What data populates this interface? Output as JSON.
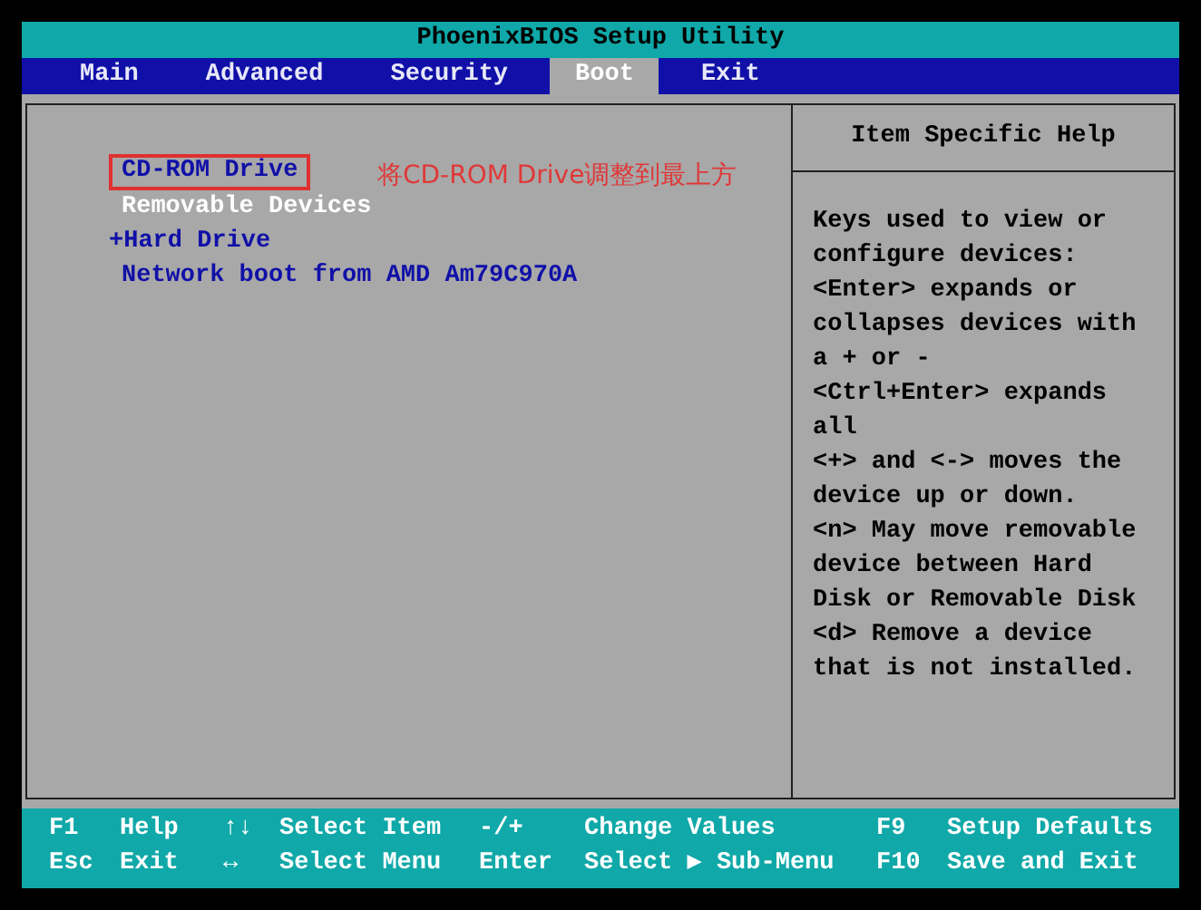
{
  "window": {
    "title": "PhoenixBIOS Setup Utility"
  },
  "tabs": [
    {
      "label": "Main",
      "selected": false
    },
    {
      "label": "Advanced",
      "selected": false
    },
    {
      "label": "Security",
      "selected": false
    },
    {
      "label": "Boot",
      "selected": true
    },
    {
      "label": "Exit",
      "selected": false
    }
  ],
  "boot_order": [
    {
      "label": "CD-ROM Drive",
      "kind": "device",
      "selected": false,
      "annotated": true
    },
    {
      "label": "Removable Devices",
      "kind": "device",
      "selected": true,
      "annotated": false
    },
    {
      "label": "+Hard Drive",
      "kind": "group",
      "selected": false,
      "annotated": false
    },
    {
      "label": "Network boot from AMD Am79C970A",
      "kind": "device",
      "selected": false,
      "annotated": false
    }
  ],
  "annotation": {
    "text": "将CD-ROM Drive调整到最上方"
  },
  "help": {
    "title": "Item Specific Help",
    "text": "Keys used to view or\nconfigure devices:\n<Enter> expands or\ncollapses devices with\na + or -\n<Ctrl+Enter> expands\nall\n<+> and <-> moves the\ndevice up or down.\n<n> May move removable\ndevice between Hard\nDisk or Removable Disk\n<d> Remove a device\nthat is not installed."
  },
  "status_bar": [
    [
      {
        "key": "F1",
        "action": "Help"
      },
      {
        "key": "↑↓",
        "action": "Select Item"
      },
      {
        "key": "-/+",
        "action": "Change Values"
      },
      {
        "key": "F9",
        "action": "Setup Defaults"
      }
    ],
    [
      {
        "key": "Esc",
        "action": "Exit"
      },
      {
        "key": "↔",
        "action": "Select Menu"
      },
      {
        "key": "Enter",
        "action": "Select ▶ Sub-Menu"
      },
      {
        "key": "F10",
        "action": "Save and Exit"
      }
    ]
  ]
}
